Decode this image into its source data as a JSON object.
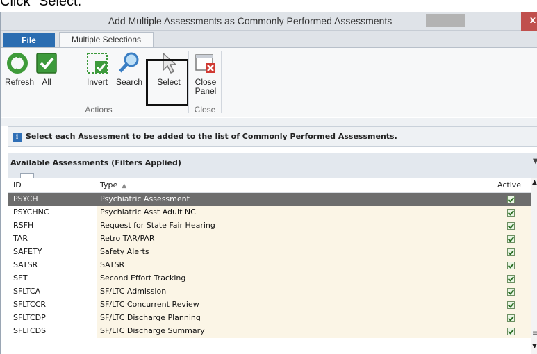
{
  "caption": "Click \"Select.\"",
  "window": {
    "title": "Add Multiple Assessments as Commonly Performed Assessments",
    "close_glyph": "x"
  },
  "tabs": {
    "file": "File",
    "active": "Multiple Selections"
  },
  "ribbon": {
    "buttons": [
      {
        "label": "Refresh",
        "icon": "refresh-icon"
      },
      {
        "label": "All",
        "icon": "check-all-icon"
      },
      {
        "label": "Invert",
        "icon": "invert-selection-icon"
      },
      {
        "label": "Search",
        "icon": "search-icon"
      },
      {
        "label": "Select",
        "icon": "cursor-select-icon"
      },
      {
        "label": "Close Panel",
        "icon": "close-panel-icon"
      }
    ],
    "groups": {
      "actions": "Actions",
      "close": "Close"
    }
  },
  "info": {
    "text": "Select each Assessment to be added to the list of Commonly Performed Assessments.",
    "icon": "info-icon"
  },
  "panel": {
    "title": "Available Assessments (Filters Applied)",
    "filter_glyph": "…"
  },
  "grid": {
    "columns": {
      "id": "ID",
      "type": "Type",
      "active": "Active"
    },
    "sort": "ascending by Type",
    "rows": [
      {
        "id": "PSYCH",
        "type": "Psychiatric Assessment",
        "active": true,
        "selected": true
      },
      {
        "id": "PSYCHNC",
        "type": "Psychiatric Asst Adult NC",
        "active": true
      },
      {
        "id": "RSFH",
        "type": "Request for State Fair Hearing",
        "active": true
      },
      {
        "id": "TAR",
        "type": "Retro TAR/PAR",
        "active": true
      },
      {
        "id": "SAFETY",
        "type": "Safety Alerts",
        "active": true
      },
      {
        "id": "SATSR",
        "type": "SATSR",
        "active": true
      },
      {
        "id": "SET",
        "type": "Second Effort Tracking",
        "active": true
      },
      {
        "id": "SFLTCA",
        "type": "SF/LTC Admission",
        "active": true
      },
      {
        "id": "SFLTCCR",
        "type": "SF/LTC Concurrent Review",
        "active": true
      },
      {
        "id": "SFLTCDP",
        "type": "SF/LTC Discharge Planning",
        "active": true
      },
      {
        "id": "SFLTCDS",
        "type": "SF/LTC Discharge Summary",
        "active": true
      }
    ]
  },
  "colors": {
    "file_tab": "#2b6db1",
    "close_button": "#c0504d",
    "selected_row": "#6d6d6d",
    "type_cell": "#fbf5e6"
  }
}
